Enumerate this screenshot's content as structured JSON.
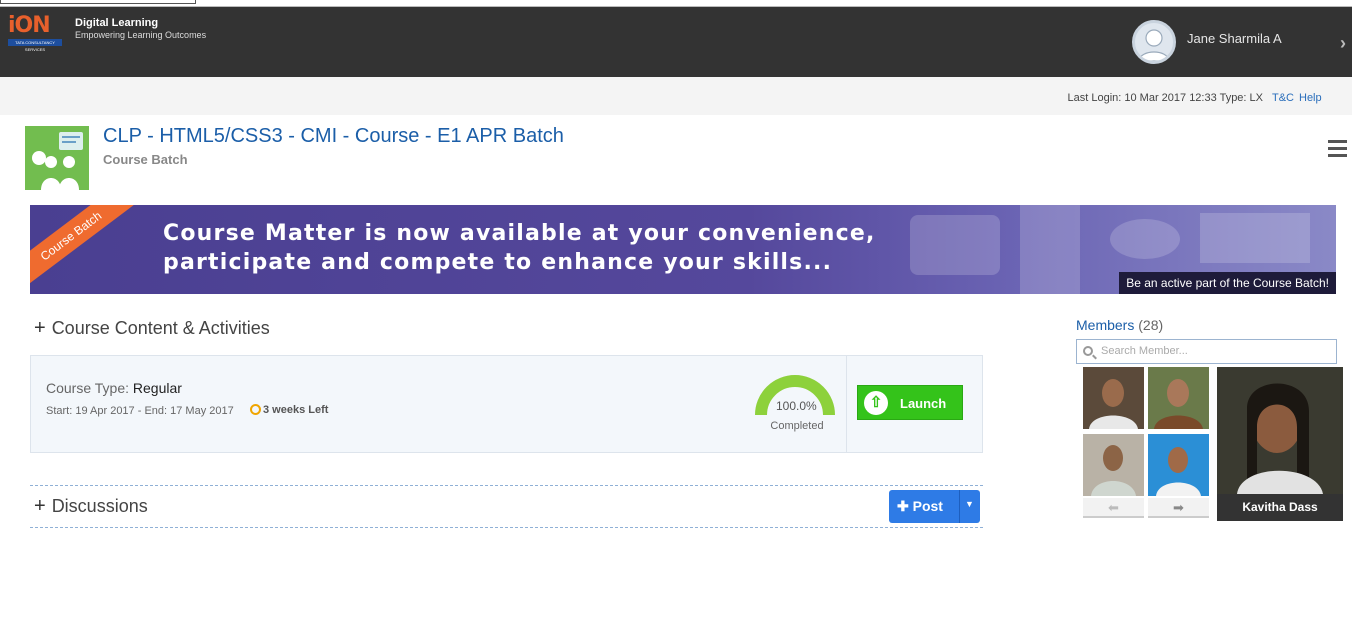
{
  "header": {
    "logo_text": "iON",
    "logo_sub": "TATA CONSULTANCY SERVICES",
    "brand_title": "Digital Learning",
    "brand_tagline": "Empowering Learning Outcomes",
    "user_name": "Jane Sharmila A",
    "close_glyph": "›"
  },
  "subbar": {
    "last_login": "Last Login: 10 Mar 2017 12:33 Type: LX",
    "tc_label": "T&C",
    "help_label": "Help"
  },
  "course": {
    "title": "CLP - HTML5/CSS3 - CMI - Course - E1 APR Batch",
    "subtitle": "Course Batch"
  },
  "banner": {
    "ribbon": "Course Batch",
    "line1": "Course Matter is now available at your convenience,",
    "line2": "participate and compete to enhance your skills...",
    "tagline": "Be an active part of the Course Batch!"
  },
  "content_section": {
    "heading": "Course Content & Activities",
    "course_type_label": "Course Type:",
    "course_type_value": "Regular",
    "dates": "Start: 19 Apr 2017 - End: 17 May 2017",
    "time_left": "3 weeks Left",
    "progress_text": "100.0%",
    "progress_value": 100,
    "progress_label": "Completed",
    "launch_label": "Launch"
  },
  "discussions": {
    "heading": "Discussions",
    "post_label": "Post"
  },
  "members": {
    "label": "Members",
    "count": "(28)",
    "search_placeholder": "Search Member...",
    "featured_name": "Kavitha Dass",
    "prev_glyph": "⬅",
    "next_glyph": "➡"
  },
  "colors": {
    "header_bg": "#333333",
    "link_blue": "#1b5ea8",
    "launch_green": "#34c31a",
    "gauge_green": "#8dd13b",
    "post_blue": "#2e7be6",
    "banner_purple": "#4a3f91",
    "ribbon_orange": "#ef6b2f"
  }
}
